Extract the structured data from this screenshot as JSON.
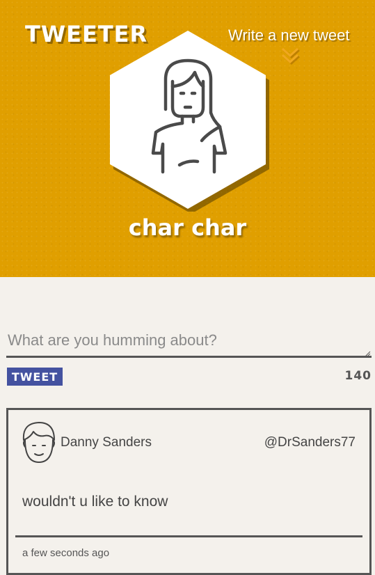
{
  "header": {
    "brand": "TWEETER",
    "compose_link": "Write a new tweet",
    "compose_arrow_icon": "double-chevron-down-icon",
    "profile_avatar_icon": "person-long-hair-icon",
    "profile_name": "char char",
    "background_color": "#e09f00"
  },
  "composer": {
    "placeholder": "What are you humming about?",
    "value": "",
    "tweet_button": "TWEET",
    "tweet_button_color": "#4452a0",
    "char_count": "140"
  },
  "tweets": [
    {
      "avatar_icon": "person-short-hair-icon",
      "name": "Danny Sanders",
      "handle": "@DrSanders77",
      "text": "wouldn't u like to know",
      "time": "a few seconds ago"
    }
  ]
}
